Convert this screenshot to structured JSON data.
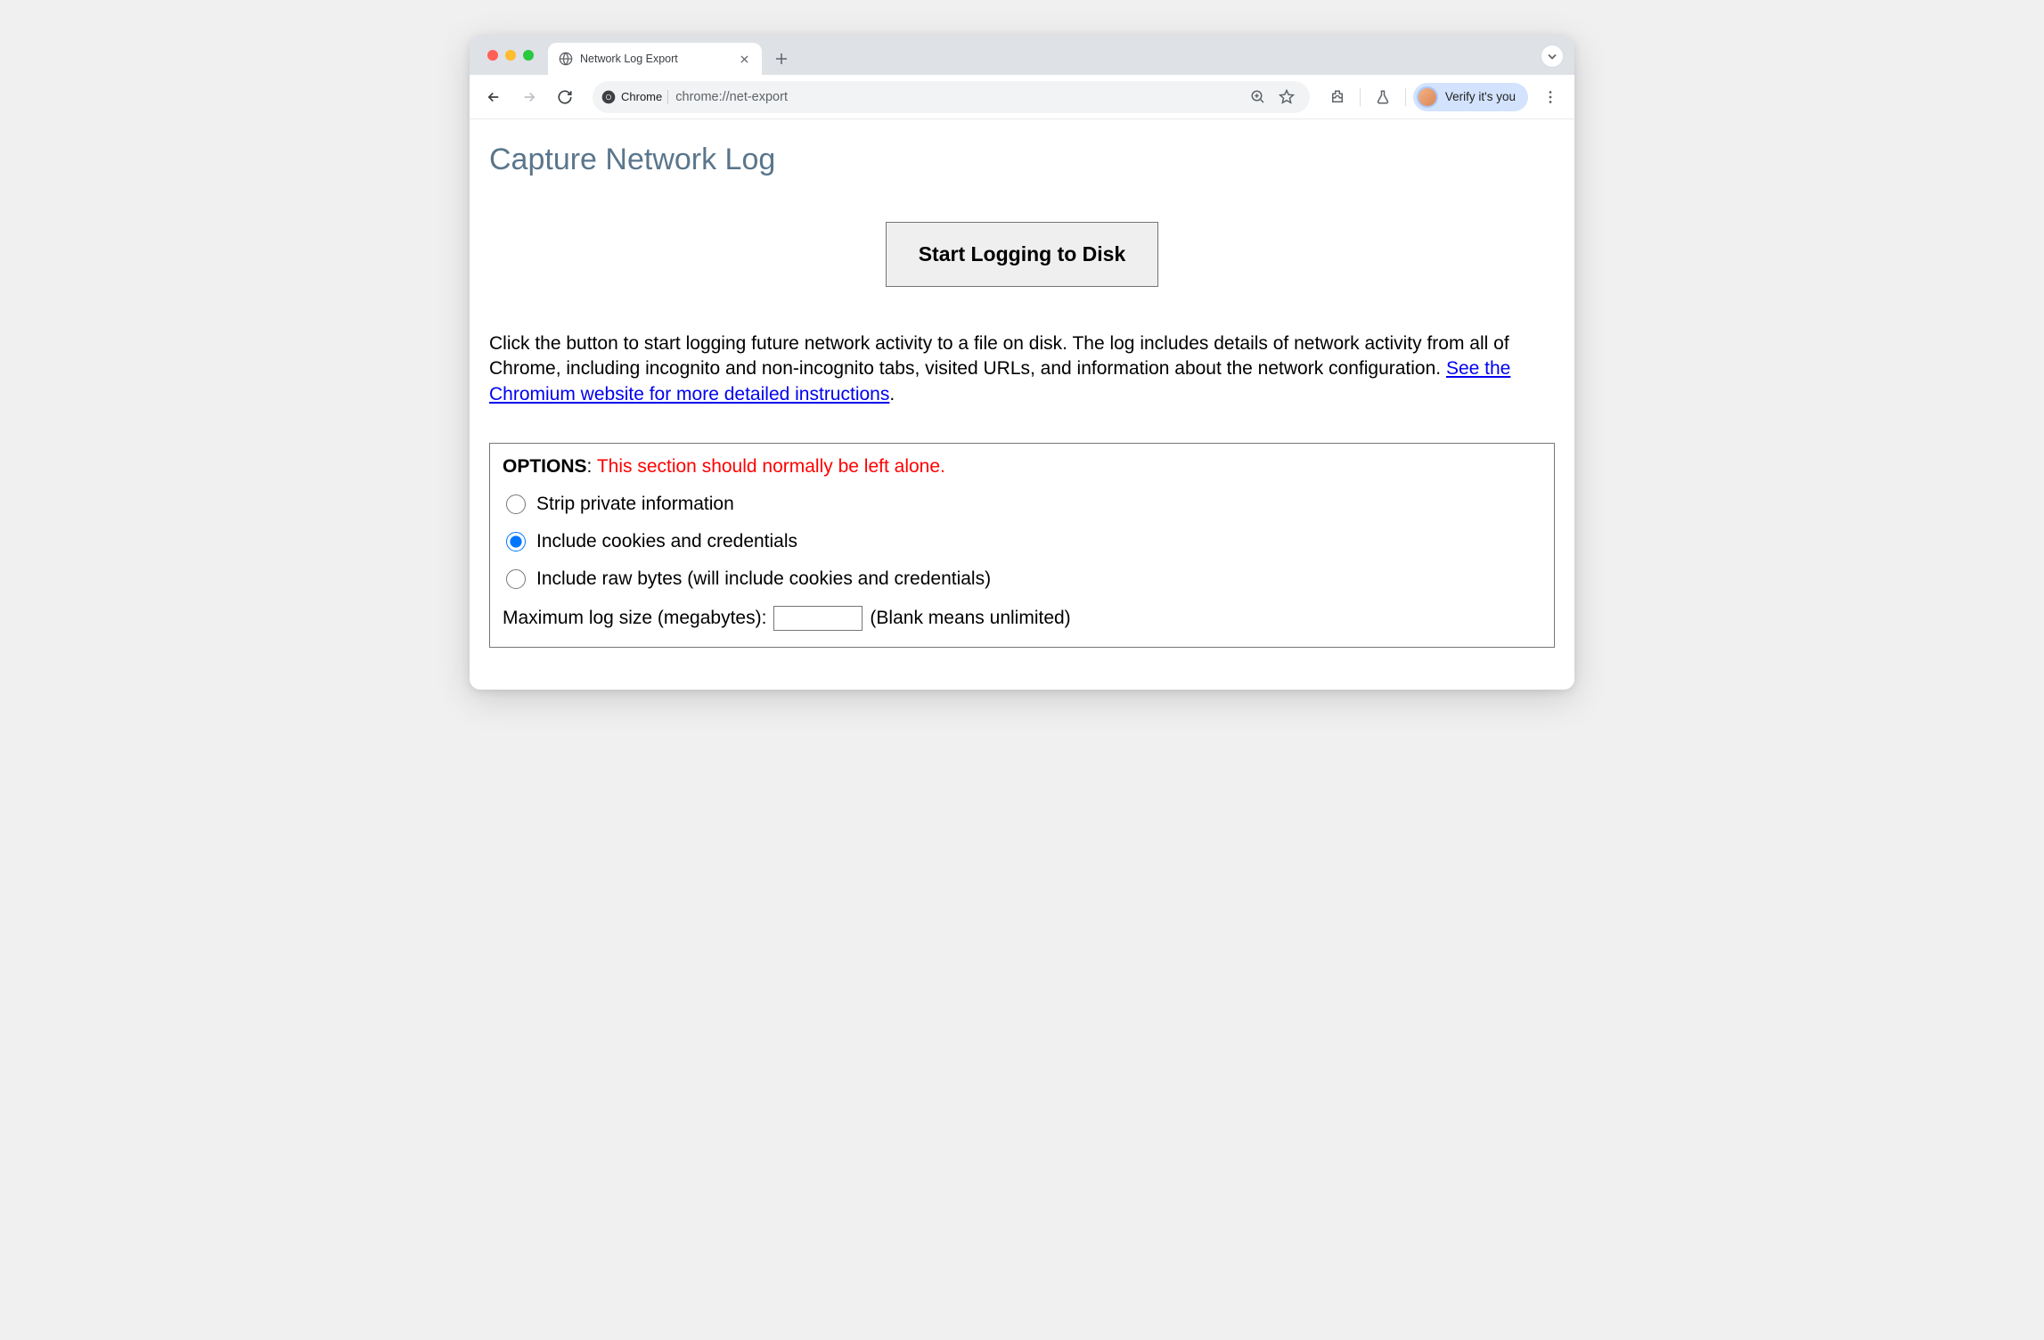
{
  "tab": {
    "title": "Network Log Export"
  },
  "toolbar": {
    "chrome_label": "Chrome",
    "url": "chrome://net-export",
    "verify_label": "Verify it's you"
  },
  "page": {
    "title": "Capture Network Log",
    "start_button": "Start Logging to Disk",
    "description_before_link": "Click the button to start logging future network activity to a file on disk. The log includes details of network activity from all of Chrome, including incognito and non-incognito tabs, visited URLs, and information about the network configuration. ",
    "link_text": "See the Chromium website for more detailed instructions",
    "description_after_link": "."
  },
  "options": {
    "header_label": "OPTIONS",
    "header_colon": ": ",
    "warning": "This section should normally be left alone.",
    "radios": [
      {
        "label": "Strip private information",
        "checked": false
      },
      {
        "label": "Include cookies and credentials",
        "checked": true
      },
      {
        "label": "Include raw bytes (will include cookies and credentials)",
        "checked": false
      }
    ],
    "max_size_label": "Maximum log size (megabytes):",
    "max_size_value": "",
    "max_size_hint": "(Blank means unlimited)"
  }
}
